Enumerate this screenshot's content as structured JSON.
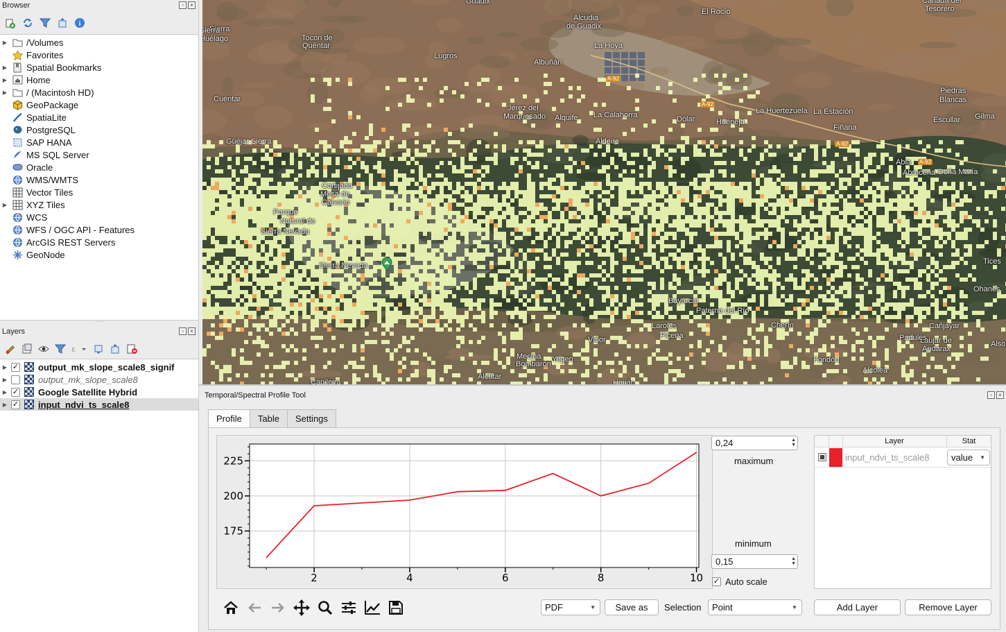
{
  "browser": {
    "title": "Browser",
    "toolbar_icons": [
      "add-layer-icon",
      "refresh-icon",
      "filter-icon",
      "collapse-all-icon",
      "info-icon"
    ],
    "items": [
      {
        "label": "/Volumes",
        "icon": "folder-icon",
        "expandable": true
      },
      {
        "label": "Favorites",
        "icon": "star-icon",
        "expandable": false
      },
      {
        "label": "Spatial Bookmarks",
        "icon": "bookmark-icon",
        "expandable": true
      },
      {
        "label": "Home",
        "icon": "home-folder-icon",
        "expandable": true
      },
      {
        "label": "/ (Macintosh HD)",
        "icon": "folder-icon",
        "expandable": true
      },
      {
        "label": "GeoPackage",
        "icon": "geopackage-icon",
        "expandable": false
      },
      {
        "label": "SpatiaLite",
        "icon": "spatialite-icon",
        "expandable": false
      },
      {
        "label": "PostgreSQL",
        "icon": "postgresql-icon",
        "expandable": false
      },
      {
        "label": "SAP HANA",
        "icon": "sap-hana-icon",
        "expandable": false
      },
      {
        "label": "MS SQL Server",
        "icon": "mssql-icon",
        "expandable": false
      },
      {
        "label": "Oracle",
        "icon": "oracle-icon",
        "expandable": false
      },
      {
        "label": "WMS/WMTS",
        "icon": "globe-icon",
        "expandable": false
      },
      {
        "label": "Vector Tiles",
        "icon": "grid-icon",
        "expandable": false
      },
      {
        "label": "XYZ Tiles",
        "icon": "grid-icon",
        "expandable": true
      },
      {
        "label": "WCS",
        "icon": "globe-icon",
        "expandable": false
      },
      {
        "label": "WFS / OGC API - Features",
        "icon": "globe-icon",
        "expandable": false
      },
      {
        "label": "ArcGIS REST Servers",
        "icon": "globe-icon",
        "expandable": false
      },
      {
        "label": "GeoNode",
        "icon": "geonode-icon",
        "expandable": false
      }
    ]
  },
  "layers": {
    "title": "Layers",
    "toolbar_icons": [
      "style-icon",
      "add-group-icon",
      "visibility-icon",
      "filter-icon",
      "expression-filter-icon",
      "expand-all-icon",
      "collapse-all-icon",
      "remove-layer-icon"
    ],
    "items": [
      {
        "label": "output_mk_slope_scale8_signif",
        "checked": true,
        "bold": true,
        "italic": false,
        "underline": false,
        "selected": false
      },
      {
        "label": "output_mk_slope_scale8",
        "checked": false,
        "bold": false,
        "italic": true,
        "underline": false,
        "selected": false
      },
      {
        "label": "Google Satellite Hybrid",
        "checked": true,
        "bold": true,
        "italic": false,
        "underline": false,
        "selected": false
      },
      {
        "label": "input_ndvi_ts_scale8",
        "checked": true,
        "bold": true,
        "italic": false,
        "underline": true,
        "selected": true
      }
    ]
  },
  "map": {
    "labels": [
      {
        "text": "Guadix"
      },
      {
        "text": "El Rocío"
      },
      {
        "text": "Cañada del"
      },
      {
        "text": "Tesorero"
      },
      {
        "text": "Alcudia"
      },
      {
        "text": "de Guadix"
      },
      {
        "text": "Sierra"
      },
      {
        "text": "Tocón de"
      },
      {
        "text": "Quéntar"
      },
      {
        "text": "Lugros"
      },
      {
        "text": "Albuñán"
      },
      {
        "text": "La Hoya"
      },
      {
        "text": "Sierra"
      },
      {
        "text": "Huélago"
      },
      {
        "text": "Cuéntar"
      },
      {
        "text": "Jérez del"
      },
      {
        "text": "Marquesado"
      },
      {
        "text": "Alquife"
      },
      {
        "text": "La Calahorra"
      },
      {
        "text": "Dólar"
      },
      {
        "text": "Huéneja"
      },
      {
        "text": "La Huertezuela"
      },
      {
        "text": "La Estación"
      },
      {
        "text": "Piedras"
      },
      {
        "text": "Blancas"
      },
      {
        "text": "Escúllar"
      },
      {
        "text": "Gilma"
      },
      {
        "text": "Güéjar Sierra"
      },
      {
        "text": "Aldeire"
      },
      {
        "text": "Fiñana"
      },
      {
        "text": "Abla"
      },
      {
        "text": "Abrucena"
      },
      {
        "text": "Doña María"
      },
      {
        "text": "Cortijada"
      },
      {
        "text": "Mesa de"
      },
      {
        "text": "Calvario"
      },
      {
        "text": "Parque"
      },
      {
        "text": "Natural de"
      },
      {
        "text": "Sierra Nevada"
      },
      {
        "text": "Sierra Nevada"
      },
      {
        "text": "Tices"
      },
      {
        "text": "Ohanes"
      },
      {
        "text": "Bayárcal"
      },
      {
        "text": "Paterna del Río"
      },
      {
        "text": "Laroles"
      },
      {
        "text": "Picena"
      },
      {
        "text": "Cherín"
      },
      {
        "text": "Cañjáyar"
      },
      {
        "text": "Válor"
      },
      {
        "text": "Laujar de"
      },
      {
        "text": "Andarax"
      },
      {
        "text": "Padules"
      },
      {
        "text": "Mecina"
      },
      {
        "text": "Bombarón"
      },
      {
        "text": "Yegen"
      },
      {
        "text": "Fondón"
      },
      {
        "text": "Alcolea"
      },
      {
        "text": "Capileira"
      },
      {
        "text": "Alcútar"
      },
      {
        "text": "Ugíjar"
      },
      {
        "text": "Alsodux"
      }
    ],
    "road_shields": [
      "A-92",
      "A-92",
      "A-92",
      "A-92"
    ]
  },
  "profile_tool": {
    "title": "Temporal/Spectral Profile Tool",
    "tabs": [
      "Profile",
      "Table",
      "Settings"
    ],
    "active_tab": "Profile",
    "maximum_value": "0,24",
    "maximum_label": "maximum",
    "minimum_label": "minimum",
    "minimum_value": "0,15",
    "auto_scale_label": "Auto scale",
    "auto_scale_checked": true,
    "layer_table": {
      "headers": [
        "Layer",
        "Stat"
      ],
      "rows": [
        {
          "layer": "input_ndvi_ts_scale8",
          "stat": "value",
          "color": "#e8202a"
        }
      ]
    },
    "export_format": "PDF",
    "save_as_label": "Save as",
    "selection_label": "Selection",
    "selection_value": "Point",
    "add_layer_label": "Add Layer",
    "remove_layer_label": "Remove Layer",
    "nav_icons": [
      "home-icon",
      "back-arrow-icon",
      "forward-arrow-icon",
      "pan-icon",
      "zoom-icon",
      "configure-subplots-icon",
      "edit-curves-icon",
      "save-figure-icon"
    ]
  },
  "chart_data": {
    "type": "line",
    "x": [
      1,
      2,
      3,
      4,
      5,
      6,
      7,
      8,
      9,
      10
    ],
    "series": [
      {
        "values": [
          156,
          193,
          195,
          197,
          203,
          204,
          216,
          200,
          209,
          231
        ],
        "color": "#e8202a"
      }
    ],
    "xticks": [
      2,
      4,
      6,
      8,
      10
    ],
    "yticks": [
      175,
      200,
      225
    ],
    "xlim": [
      0.65,
      10.05
    ],
    "ylim": [
      149,
      237
    ],
    "grid": true
  }
}
